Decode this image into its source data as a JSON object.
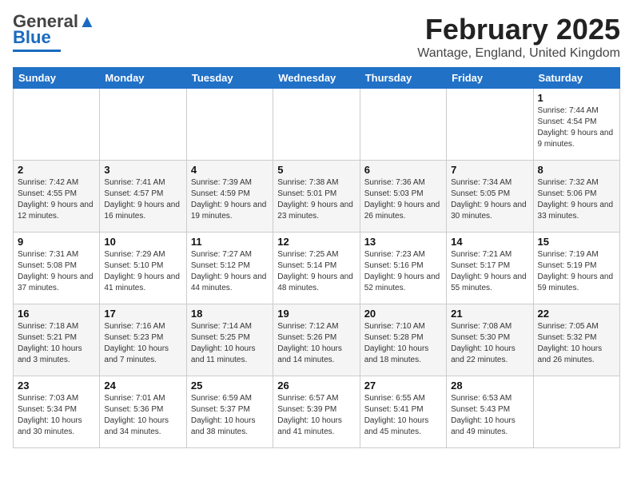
{
  "header": {
    "logo_general": "General",
    "logo_blue": "Blue",
    "month_title": "February 2025",
    "location": "Wantage, England, United Kingdom"
  },
  "weekdays": [
    "Sunday",
    "Monday",
    "Tuesday",
    "Wednesday",
    "Thursday",
    "Friday",
    "Saturday"
  ],
  "weeks": [
    [
      {
        "day": "",
        "info": ""
      },
      {
        "day": "",
        "info": ""
      },
      {
        "day": "",
        "info": ""
      },
      {
        "day": "",
        "info": ""
      },
      {
        "day": "",
        "info": ""
      },
      {
        "day": "",
        "info": ""
      },
      {
        "day": "1",
        "info": "Sunrise: 7:44 AM\nSunset: 4:54 PM\nDaylight: 9 hours and 9 minutes."
      }
    ],
    [
      {
        "day": "2",
        "info": "Sunrise: 7:42 AM\nSunset: 4:55 PM\nDaylight: 9 hours and 12 minutes."
      },
      {
        "day": "3",
        "info": "Sunrise: 7:41 AM\nSunset: 4:57 PM\nDaylight: 9 hours and 16 minutes."
      },
      {
        "day": "4",
        "info": "Sunrise: 7:39 AM\nSunset: 4:59 PM\nDaylight: 9 hours and 19 minutes."
      },
      {
        "day": "5",
        "info": "Sunrise: 7:38 AM\nSunset: 5:01 PM\nDaylight: 9 hours and 23 minutes."
      },
      {
        "day": "6",
        "info": "Sunrise: 7:36 AM\nSunset: 5:03 PM\nDaylight: 9 hours and 26 minutes."
      },
      {
        "day": "7",
        "info": "Sunrise: 7:34 AM\nSunset: 5:05 PM\nDaylight: 9 hours and 30 minutes."
      },
      {
        "day": "8",
        "info": "Sunrise: 7:32 AM\nSunset: 5:06 PM\nDaylight: 9 hours and 33 minutes."
      }
    ],
    [
      {
        "day": "9",
        "info": "Sunrise: 7:31 AM\nSunset: 5:08 PM\nDaylight: 9 hours and 37 minutes."
      },
      {
        "day": "10",
        "info": "Sunrise: 7:29 AM\nSunset: 5:10 PM\nDaylight: 9 hours and 41 minutes."
      },
      {
        "day": "11",
        "info": "Sunrise: 7:27 AM\nSunset: 5:12 PM\nDaylight: 9 hours and 44 minutes."
      },
      {
        "day": "12",
        "info": "Sunrise: 7:25 AM\nSunset: 5:14 PM\nDaylight: 9 hours and 48 minutes."
      },
      {
        "day": "13",
        "info": "Sunrise: 7:23 AM\nSunset: 5:16 PM\nDaylight: 9 hours and 52 minutes."
      },
      {
        "day": "14",
        "info": "Sunrise: 7:21 AM\nSunset: 5:17 PM\nDaylight: 9 hours and 55 minutes."
      },
      {
        "day": "15",
        "info": "Sunrise: 7:19 AM\nSunset: 5:19 PM\nDaylight: 9 hours and 59 minutes."
      }
    ],
    [
      {
        "day": "16",
        "info": "Sunrise: 7:18 AM\nSunset: 5:21 PM\nDaylight: 10 hours and 3 minutes."
      },
      {
        "day": "17",
        "info": "Sunrise: 7:16 AM\nSunset: 5:23 PM\nDaylight: 10 hours and 7 minutes."
      },
      {
        "day": "18",
        "info": "Sunrise: 7:14 AM\nSunset: 5:25 PM\nDaylight: 10 hours and 11 minutes."
      },
      {
        "day": "19",
        "info": "Sunrise: 7:12 AM\nSunset: 5:26 PM\nDaylight: 10 hours and 14 minutes."
      },
      {
        "day": "20",
        "info": "Sunrise: 7:10 AM\nSunset: 5:28 PM\nDaylight: 10 hours and 18 minutes."
      },
      {
        "day": "21",
        "info": "Sunrise: 7:08 AM\nSunset: 5:30 PM\nDaylight: 10 hours and 22 minutes."
      },
      {
        "day": "22",
        "info": "Sunrise: 7:05 AM\nSunset: 5:32 PM\nDaylight: 10 hours and 26 minutes."
      }
    ],
    [
      {
        "day": "23",
        "info": "Sunrise: 7:03 AM\nSunset: 5:34 PM\nDaylight: 10 hours and 30 minutes."
      },
      {
        "day": "24",
        "info": "Sunrise: 7:01 AM\nSunset: 5:36 PM\nDaylight: 10 hours and 34 minutes."
      },
      {
        "day": "25",
        "info": "Sunrise: 6:59 AM\nSunset: 5:37 PM\nDaylight: 10 hours and 38 minutes."
      },
      {
        "day": "26",
        "info": "Sunrise: 6:57 AM\nSunset: 5:39 PM\nDaylight: 10 hours and 41 minutes."
      },
      {
        "day": "27",
        "info": "Sunrise: 6:55 AM\nSunset: 5:41 PM\nDaylight: 10 hours and 45 minutes."
      },
      {
        "day": "28",
        "info": "Sunrise: 6:53 AM\nSunset: 5:43 PM\nDaylight: 10 hours and 49 minutes."
      },
      {
        "day": "",
        "info": ""
      }
    ]
  ]
}
